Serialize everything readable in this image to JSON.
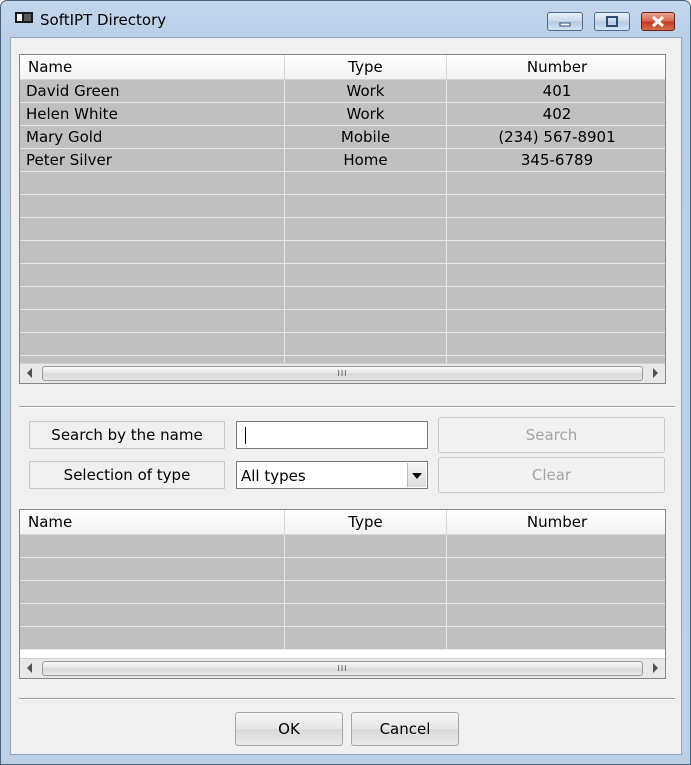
{
  "window": {
    "title": "SoftIPT Directory"
  },
  "directory": {
    "columns": [
      "Name",
      "Type",
      "Number"
    ],
    "rows": [
      {
        "name": "David Green",
        "type": "Work",
        "number": "401"
      },
      {
        "name": "Helen White",
        "type": "Work",
        "number": "402"
      },
      {
        "name": "Mary Gold",
        "type": "Mobile",
        "number": "(234) 567-8901"
      },
      {
        "name": "Peter Silver",
        "type": "Home",
        "number": "345-6789"
      }
    ]
  },
  "search": {
    "name_label": "Search by the name",
    "name_value": "",
    "search_button": "Search",
    "type_label": "Selection of type",
    "type_selected": "All types",
    "clear_button": "Clear"
  },
  "results": {
    "columns": [
      "Name",
      "Type",
      "Number"
    ],
    "rows": []
  },
  "scrollbar": {
    "grip": "III"
  },
  "footer": {
    "ok": "OK",
    "cancel": "Cancel"
  }
}
